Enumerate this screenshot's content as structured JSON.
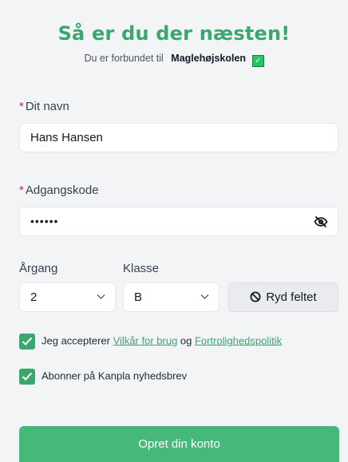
{
  "header": {
    "title": "Så er du der næsten!",
    "connected_text": "Du er forbundet til",
    "school_name": "Maglehøjskolen"
  },
  "form": {
    "name": {
      "required_mark": "*",
      "label": "Dit navn",
      "value": "Hans Hansen"
    },
    "password": {
      "required_mark": "*",
      "label": "Adgangskode",
      "value": "••••••",
      "toggle_icon": "eye-slash-icon"
    },
    "year": {
      "label": "Årgang",
      "value": "2"
    },
    "class": {
      "label": "Klasse",
      "value": "B"
    },
    "clear_button": "Ryd feltet"
  },
  "consents": {
    "terms": {
      "checked": true,
      "prefix": "Jeg accepterer ",
      "terms_link": "Vilkår for brug",
      "middle": " og ",
      "privacy_link": "Fortrolighedspolitik"
    },
    "newsletter": {
      "checked": true,
      "label": "Abonner på Kanpla nyhedsbrev"
    }
  },
  "submit_label": "Opret din konto",
  "colors": {
    "accent": "#3aa76d",
    "required": "#e11d48",
    "button": "#45b87a"
  }
}
